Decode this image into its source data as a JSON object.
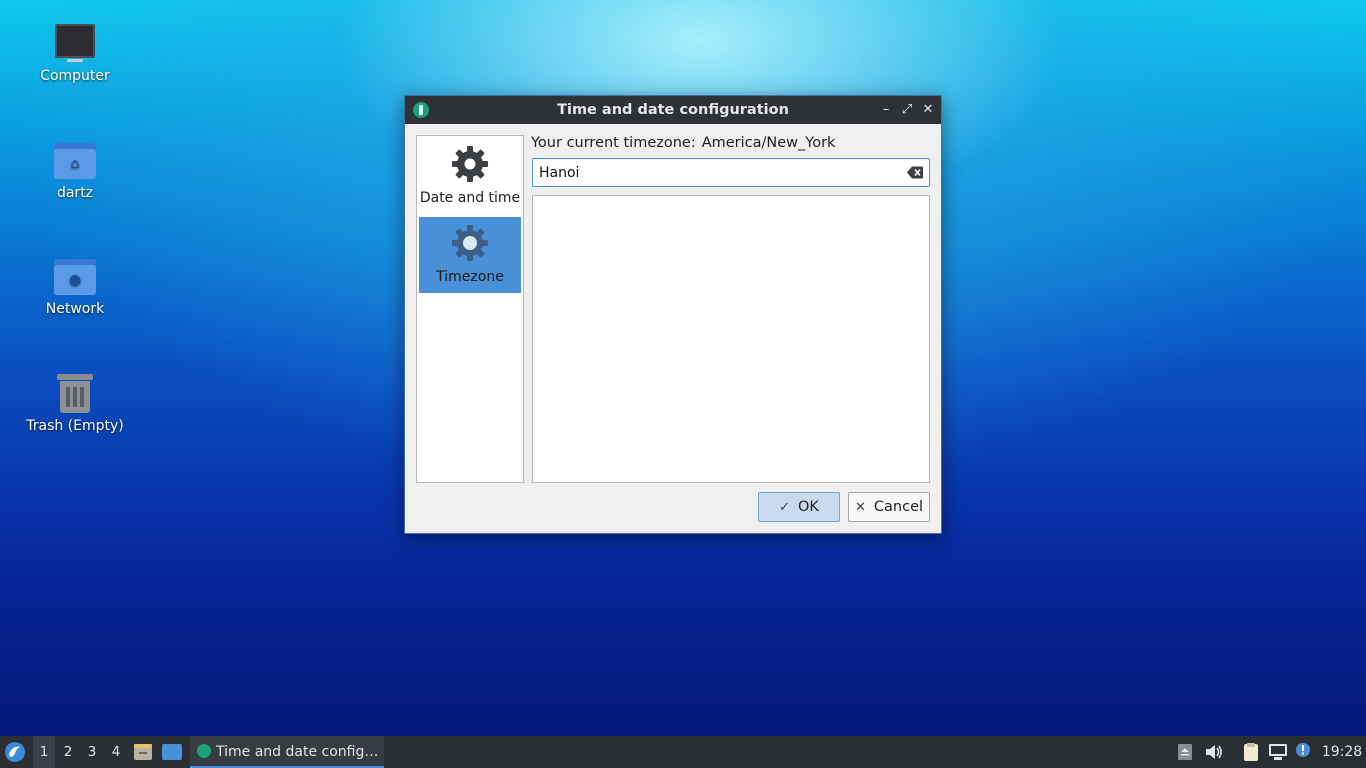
{
  "desktop": {
    "icons": [
      {
        "label": "Computer"
      },
      {
        "label": "dartz"
      },
      {
        "label": "Network"
      },
      {
        "label": "Trash (Empty)"
      }
    ]
  },
  "dialog": {
    "title": "Time and date configuration",
    "sidebar": [
      {
        "label": "Date and time",
        "icon": "gear-icon",
        "active": false
      },
      {
        "label": "Timezone",
        "icon": "timezone-gear-icon",
        "active": true
      }
    ],
    "current_timezone_label": "Your current timezone:",
    "current_timezone_value": "America/New_York",
    "search_value": "Hanoi",
    "buttons": {
      "ok": "OK",
      "cancel": "Cancel"
    }
  },
  "taskbar": {
    "workspaces": [
      "1",
      "2",
      "3",
      "4"
    ],
    "active_workspace": "1",
    "task_label": "Time and date config…",
    "clock": "19:28"
  },
  "colors": {
    "accent": "#4a90d9",
    "titlebar": "#2e3136",
    "taskbar": "#2b2e33"
  }
}
